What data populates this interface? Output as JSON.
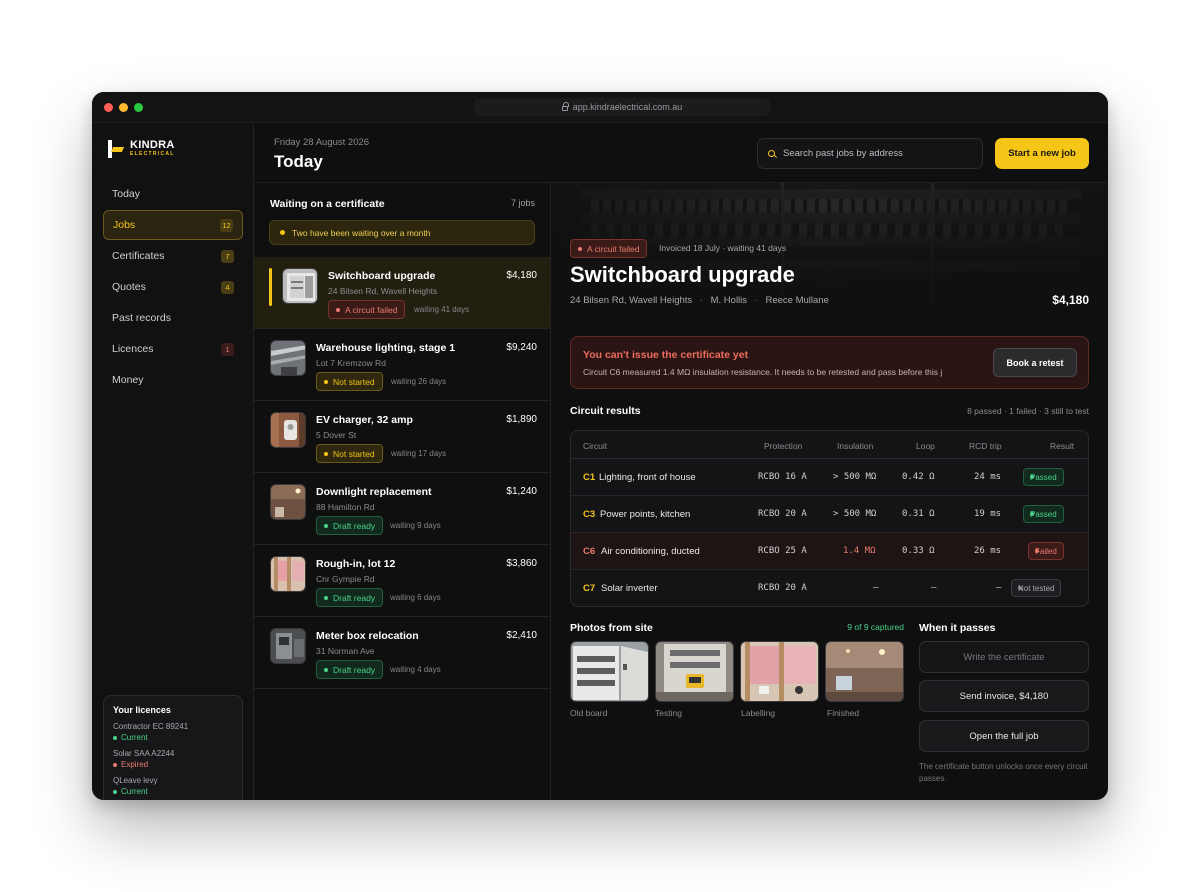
{
  "browser": {
    "url": "app.kindraelectrical.com.au"
  },
  "brand": {
    "name": "KINDRA",
    "sub": "ELECTRICAL",
    "accent": "#f5c518"
  },
  "nav": [
    {
      "label": "Today",
      "count": null
    },
    {
      "label": "Jobs",
      "count": "12"
    },
    {
      "label": "Certificates",
      "count": "7"
    },
    {
      "label": "Quotes",
      "count": "4"
    },
    {
      "label": "Past records",
      "count": null
    },
    {
      "label": "Licences",
      "count": "1"
    },
    {
      "label": "Money",
      "count": null
    }
  ],
  "licences": {
    "title": "Your licences",
    "items": [
      {
        "name": "Contractor EC 89241",
        "status": "Current",
        "color": "#4cd38a"
      },
      {
        "name": "Solar SAA A2244",
        "status": "Expired",
        "color": "#ea7b6d"
      },
      {
        "name": "QLeave levy",
        "status": "Current",
        "color": "#4cd38a"
      }
    ]
  },
  "header": {
    "date": "Friday 28 August 2026",
    "title": "Today",
    "search_placeholder": "Search past jobs by address",
    "new_job": "Start a new job"
  },
  "list": {
    "title": "Waiting on a certificate",
    "count": "7 jobs",
    "banner": "Two have been waiting over a month",
    "jobs": [
      {
        "title": "Switchboard upgrade",
        "address": "24 Bilsen Rd, Wavell Heights",
        "price": "$4,180",
        "status": "A circuit failed",
        "wait": "waiting 41 days"
      },
      {
        "title": "Warehouse lighting, stage 1",
        "address": "Lot 7 Kremzow Rd",
        "price": "$9,240",
        "status": "Not started",
        "wait": "waiting 26 days"
      },
      {
        "title": "EV charger, 32 amp",
        "address": "5 Dover St",
        "price": "$1,890",
        "status": "Not started",
        "wait": "waiting 17 days"
      },
      {
        "title": "Downlight replacement",
        "address": "88 Hamilton Rd",
        "price": "$1,240",
        "status": "Draft ready",
        "wait": "waiting 9 days"
      },
      {
        "title": "Rough-in, lot 12",
        "address": "Cnr Gympie Rd",
        "price": "$3,860",
        "status": "Draft ready",
        "wait": "waiting 6 days"
      },
      {
        "title": "Meter box relocation",
        "address": "31 Norman Ave",
        "price": "$2,410",
        "status": "Draft ready",
        "wait": "waiting 4 days"
      }
    ]
  },
  "detail": {
    "status": "A circuit failed",
    "invoiced": "Invoiced 18 July · waiting 41 days",
    "title": "Switchboard upgrade",
    "address": "24 Bilsen Rd, Wavell Heights",
    "person1": "M. Hollis",
    "person2": "Reece Mullane",
    "price": "$4,180",
    "alert_title": "You can't issue the certificate yet",
    "alert_body": "Circuit C6 measured 1.4 MΩ insulation resistance. It needs to be retested and pass before this j",
    "retest": "Book a retest"
  },
  "circuits": {
    "title": "Circuit results",
    "summary": "8 passed · 1 failed · 3 still to test",
    "columns": [
      "Circuit",
      "Protection",
      "Insulation",
      "Loop",
      "RCD trip",
      "Result"
    ],
    "rows": [
      {
        "id": "C1",
        "name": "Lighting, front of house",
        "protection": "RCBO 16 A",
        "insulation": "> 500 MΩ",
        "loop": "0.42 Ω",
        "rcd": "24 ms",
        "result": "Passed"
      },
      {
        "id": "C3",
        "name": "Power points, kitchen",
        "protection": "RCBO 20 A",
        "insulation": "> 500 MΩ",
        "loop": "0.31 Ω",
        "rcd": "19 ms",
        "result": "Passed"
      },
      {
        "id": "C6",
        "name": "Air conditioning, ducted",
        "protection": "RCBO 25 A",
        "insulation": "1.4 MΩ",
        "loop": "0.33 Ω",
        "rcd": "26 ms",
        "result": "Failed"
      },
      {
        "id": "C7",
        "name": "Solar inverter",
        "protection": "RCBO 20 A",
        "insulation": "—",
        "loop": "—",
        "rcd": "—",
        "result": "Not tested"
      }
    ]
  },
  "photos": {
    "title": "Photos from site",
    "count": "9 of 9 captured",
    "items": [
      "Old board",
      "Testing",
      "Labelling",
      "Finished"
    ]
  },
  "actions": {
    "title": "When it passes",
    "write": "Write the certificate",
    "invoice": "Send invoice, $4,180",
    "open": "Open the full job",
    "note": "The certificate button unlocks once every circuit passes."
  }
}
